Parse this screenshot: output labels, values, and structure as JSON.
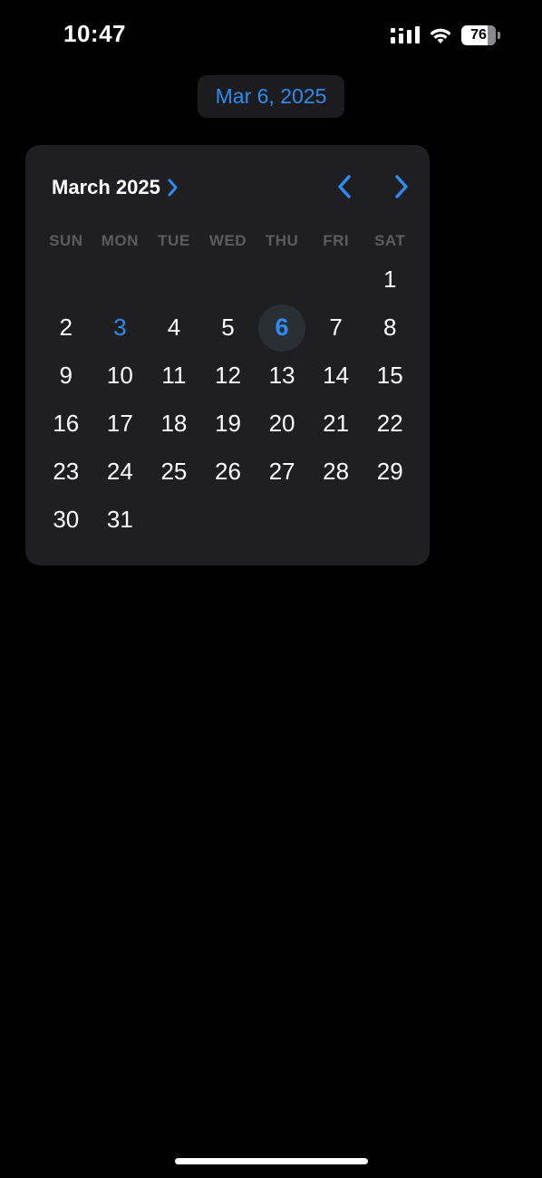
{
  "status_bar": {
    "time": "10:47",
    "battery_level": "76",
    "battery_fraction": 0.76
  },
  "date_chip": {
    "label": "Mar 6, 2025"
  },
  "calendar": {
    "month_label": "March 2025",
    "weekdays": [
      "SUN",
      "MON",
      "TUE",
      "WED",
      "THU",
      "FRI",
      "SAT"
    ],
    "first_weekday_index": 6,
    "days": [
      "1",
      "2",
      "3",
      "4",
      "5",
      "6",
      "7",
      "8",
      "9",
      "10",
      "11",
      "12",
      "13",
      "14",
      "15",
      "16",
      "17",
      "18",
      "19",
      "20",
      "21",
      "22",
      "23",
      "24",
      "25",
      "26",
      "27",
      "28",
      "29",
      "30",
      "31"
    ],
    "today": "3",
    "selected": "6",
    "icons": {
      "month_chevron": "chevron-right-icon",
      "prev": "chevron-left-icon",
      "next": "chevron-right-icon"
    }
  },
  "colors": {
    "accent": "#2f8bf0",
    "panel": "#1f1f21",
    "background": "#000000",
    "weekday_text": "#5c5c60"
  }
}
